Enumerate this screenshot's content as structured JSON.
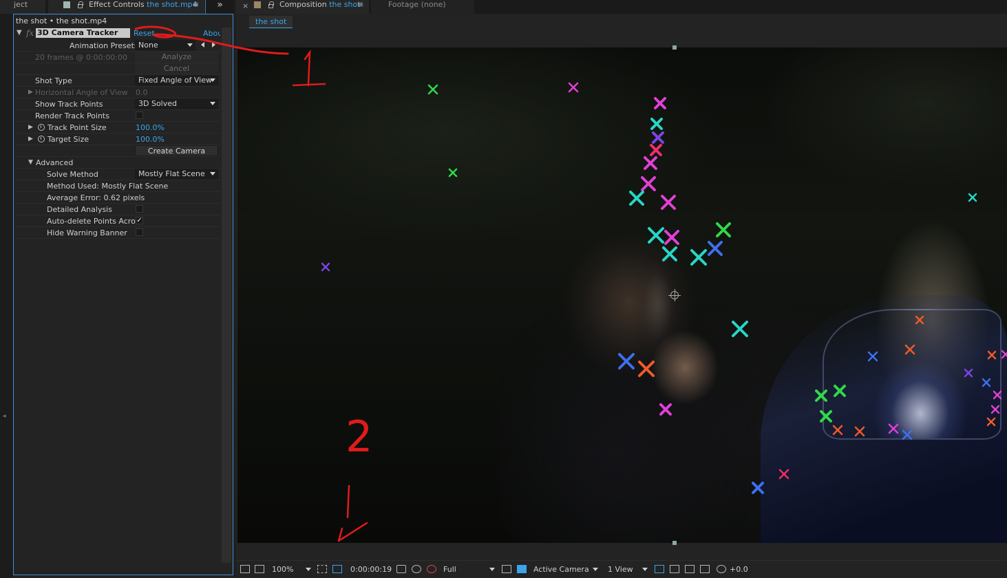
{
  "left_tabs": {
    "project_label": "ject",
    "effect_controls_label": "Effect Controls",
    "effect_controls_target": "the shot.mp4",
    "overflow_label": "»"
  },
  "breadcrumb": "the shot • the shot.mp4",
  "effect": {
    "name": "3D Camera Tracker",
    "fx_badge": "fx",
    "reset_label": "Reset",
    "about_label": "Abou",
    "animation_presets_label": "Animation Presets:",
    "animation_presets_value": "None",
    "frames_info": "20 frames @ 0:00:00:00",
    "analyze_label": "Analyze",
    "cancel_label": "Cancel",
    "shot_type_label": "Shot Type",
    "shot_type_value": "Fixed Angle of View",
    "horizontal_aov_label": "Horizontal Angle of View",
    "horizontal_aov_value": "0.0",
    "show_track_points_label": "Show Track Points",
    "show_track_points_value": "3D Solved",
    "render_track_points_label": "Render Track Points",
    "track_point_size_label": "Track Point Size",
    "track_point_size_value": "100.0%",
    "target_size_label": "Target Size",
    "target_size_value": "100.0%",
    "create_camera_label": "Create Camera",
    "advanced_label": "Advanced",
    "solve_method_label": "Solve Method",
    "solve_method_value": "Mostly Flat Scene",
    "method_used_text": "Method Used: Mostly Flat Scene",
    "average_error_text": "Average Error: 0.62 pixels",
    "detailed_analysis_label": "Detailed Analysis",
    "auto_delete_label": "Auto-delete Points Acros",
    "auto_delete_checked": "✓",
    "hide_warning_label": "Hide Warning Banner"
  },
  "right_tabs": {
    "composition_label": "Composition",
    "composition_target": "the shot",
    "footage_label": "Footage (none)"
  },
  "comp_chip": "the shot",
  "bottom_bar": {
    "zoom": "100%",
    "timecode": "0:00:00:19",
    "resolution": "Full",
    "camera": "Active Camera",
    "views": "1 View",
    "exposure": "+0.0"
  },
  "annotations": {
    "one": "1",
    "two": "2"
  },
  "colors": {
    "accent_blue": "#3ba5ec",
    "annotation_red": "#e01b1b",
    "track_green": "#2fd94a",
    "track_magenta": "#e23fd8",
    "track_cyan": "#27d6c6",
    "track_blue": "#3d6ff0",
    "track_orange": "#f05a2a",
    "track_purple": "#7a44e6",
    "track_pink": "#ef2f6a"
  }
}
